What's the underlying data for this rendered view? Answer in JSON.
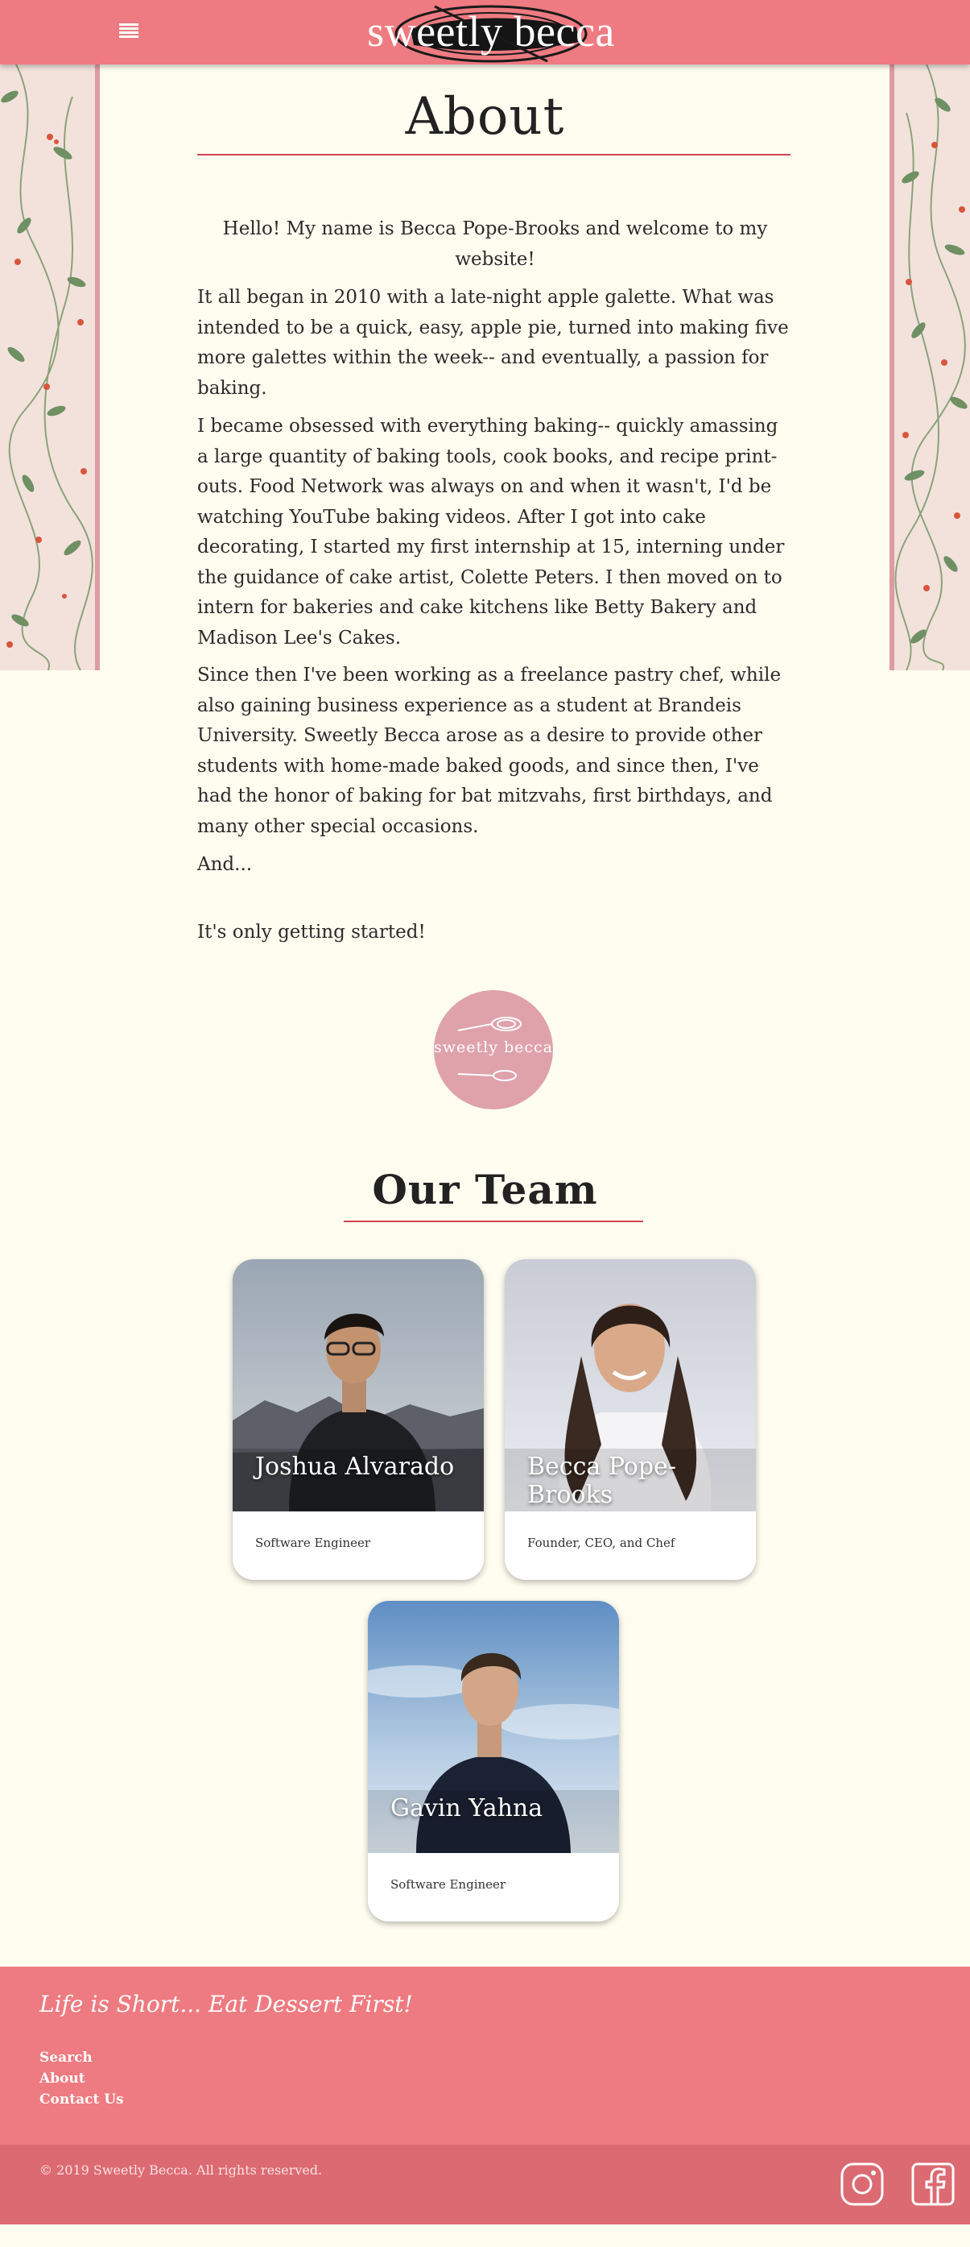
{
  "header": {
    "brand": "sweetly becca",
    "menu_icon": "hamburger-menu-icon",
    "color": "#ee7b81"
  },
  "about": {
    "title": "About",
    "paragraphs": [
      "Hello! My name is Becca Pope-Brooks and welcome to my website!",
      "It all began in 2010 with a late-night apple galette. What was intended to be a quick, easy, apple pie, turned into making five more galettes within the week-- and eventually, a passion for baking.",
      "I became obsessed with everything baking-- quickly amassing a large quantity of baking tools, cook books, and recipe print-outs. Food Network was always on and when it wasn't, I'd be watching YouTube baking videos. After I got into cake decorating, I started my first internship at 15, interning under the guidance of cake artist, Colette Peters. I then moved on to intern for bakeries and cake kitchens like Betty Bakery and Madison Lee's Cakes.",
      "Since then I've been working as a freelance pastry chef, while also gaining business experience as a student at Brandeis University. Sweetly Becca arose as a desire to provide other students with home-made baked goods, and since then, I've had the honor of baking for bat mitzvahs, first birthdays, and many other special occasions.",
      "And...",
      "It's only getting started!"
    ],
    "badge_text": "sweetly becca"
  },
  "team": {
    "title": "Our Team",
    "members": [
      {
        "name": "Joshua Alvarado",
        "role": "Software Engineer"
      },
      {
        "name": "Becca Pope-Brooks",
        "role": "Founder, CEO, and Chef"
      },
      {
        "name": "Gavin Yahna",
        "role": "Software Engineer"
      }
    ]
  },
  "footer": {
    "tagline": "Life is Short... Eat Dessert First!",
    "links": [
      "Search",
      "About",
      "Contact Us"
    ],
    "copyright": "© 2019 Sweetly Becca. All rights reserved.",
    "social": [
      "instagram-icon",
      "facebook-icon"
    ]
  },
  "colors": {
    "accent": "#ee7b81",
    "background": "#fefdf0",
    "rule": "#d3434f",
    "badge": "#dfa2ab"
  }
}
